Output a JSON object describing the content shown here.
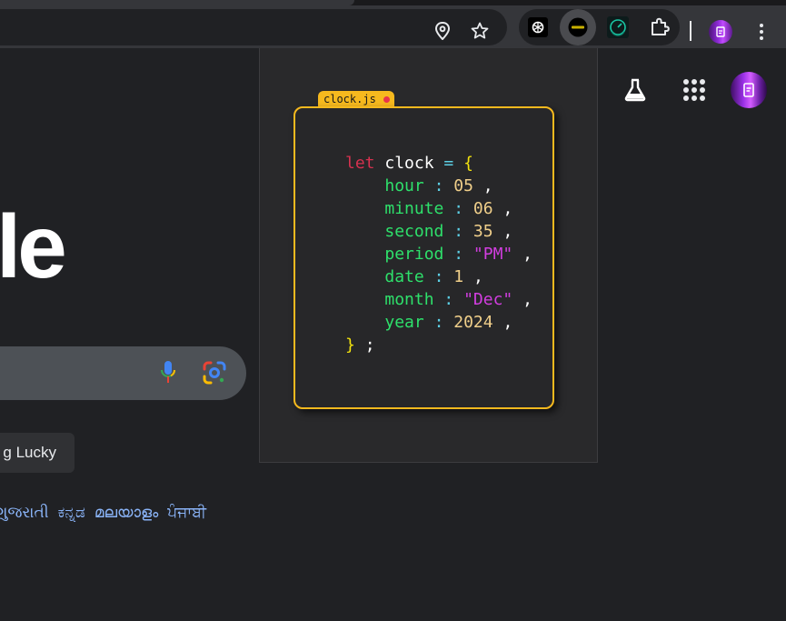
{
  "browser": {
    "omnibox_icons": [
      "location-pin-icon",
      "star-icon"
    ],
    "extensions": [
      "chatgpt-icon",
      "clock-extension-icon",
      "speedometer-icon",
      "puzzle-icon"
    ],
    "active_extension": "clock-extension-icon",
    "colors": {
      "toolbar": "#35363a",
      "omnibox": "#202124"
    }
  },
  "page": {
    "logo_fragment": "le",
    "lucky_button": "g Lucky",
    "languages": [
      "ગુજરાતી",
      "ಕನ್ನಡ",
      "മലയാളം",
      "ਪੰਜਾਬੀ"
    ],
    "colors": {
      "background": "#202124",
      "link": "#8ab4f8"
    }
  },
  "popup": {
    "filename": "clock.js",
    "code": {
      "keyword": "let",
      "variable": "clock",
      "assign": "=",
      "open": "{",
      "close": "}",
      "semicolon": ";",
      "fields": [
        {
          "key": "hour",
          "value": "05"
        },
        {
          "key": "minute",
          "value": "06"
        },
        {
          "key": "second",
          "value": "35"
        },
        {
          "key": "period",
          "value": "\"PM\""
        },
        {
          "key": "date",
          "value": "1"
        },
        {
          "key": "month",
          "value": "\"Dec\""
        },
        {
          "key": "year",
          "value": "2024"
        }
      ]
    },
    "colors": {
      "accent": "#f6b91e",
      "keyword": "#d6314f",
      "key": "#2ee06b",
      "number": "#f0cf8a",
      "string": "#d23ee0",
      "brace": "#f2e20e",
      "operator": "#5cd0e6"
    }
  }
}
